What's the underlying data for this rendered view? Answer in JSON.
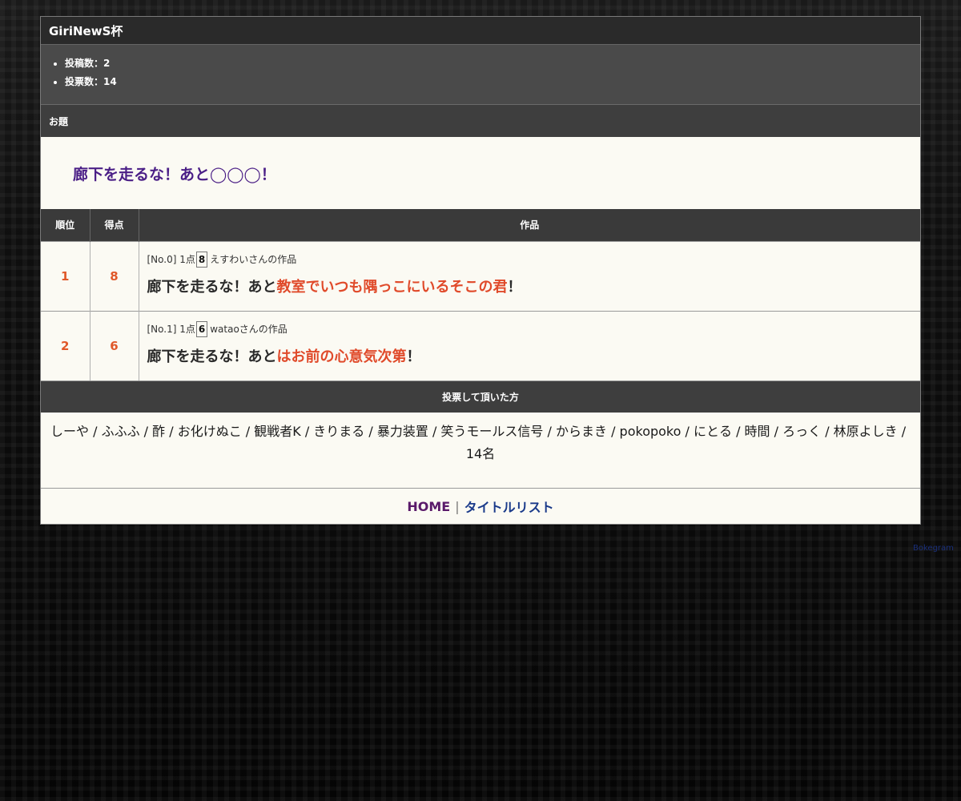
{
  "header": {
    "title": "GiriNewS杯"
  },
  "stats": {
    "posts": "投稿数：2",
    "votes": "投票数：14"
  },
  "topic": {
    "label": "お題",
    "text": "廊下を走るな！あと◯◯◯！"
  },
  "table": {
    "headers": [
      "順位",
      "得点",
      "作品"
    ],
    "rows": [
      {
        "rank": "1",
        "score": "8",
        "meta_no": "[No.0] 1点",
        "meta_pts": "8",
        "meta_author": "えすわいさんの作品",
        "prefix": "廊下を走るな！あと",
        "highlight": "教室でいつも隅っこにいるそこの君",
        "suffix": "！"
      },
      {
        "rank": "2",
        "score": "6",
        "meta_no": "[No.1] 1点",
        "meta_pts": "6",
        "meta_author": "wataoさんの作品",
        "prefix": "廊下を走るな！あと",
        "highlight": "はお前の心意気次第",
        "suffix": "！"
      }
    ]
  },
  "voters": {
    "label": "投票して頂いた方",
    "list": "しーや / ふふふ / 酢 / お化けぬこ / 観戦者K / きりまる / 暴力装置 / 笑うモールス信号 / からまき / pokopoko / にとる / 時間 / ろっく / 林原よしき /",
    "count": "14名"
  },
  "footer": {
    "home": "HOME",
    "separator": "|",
    "title_list": "タイトルリスト"
  },
  "credit": "Bokegram",
  "colors": {
    "accent_number": "#e0582a",
    "highlight": "#e04a2a",
    "topic": "#4a1e86",
    "home_link": "#5a1a6a",
    "list_link": "#1a3a8a"
  }
}
